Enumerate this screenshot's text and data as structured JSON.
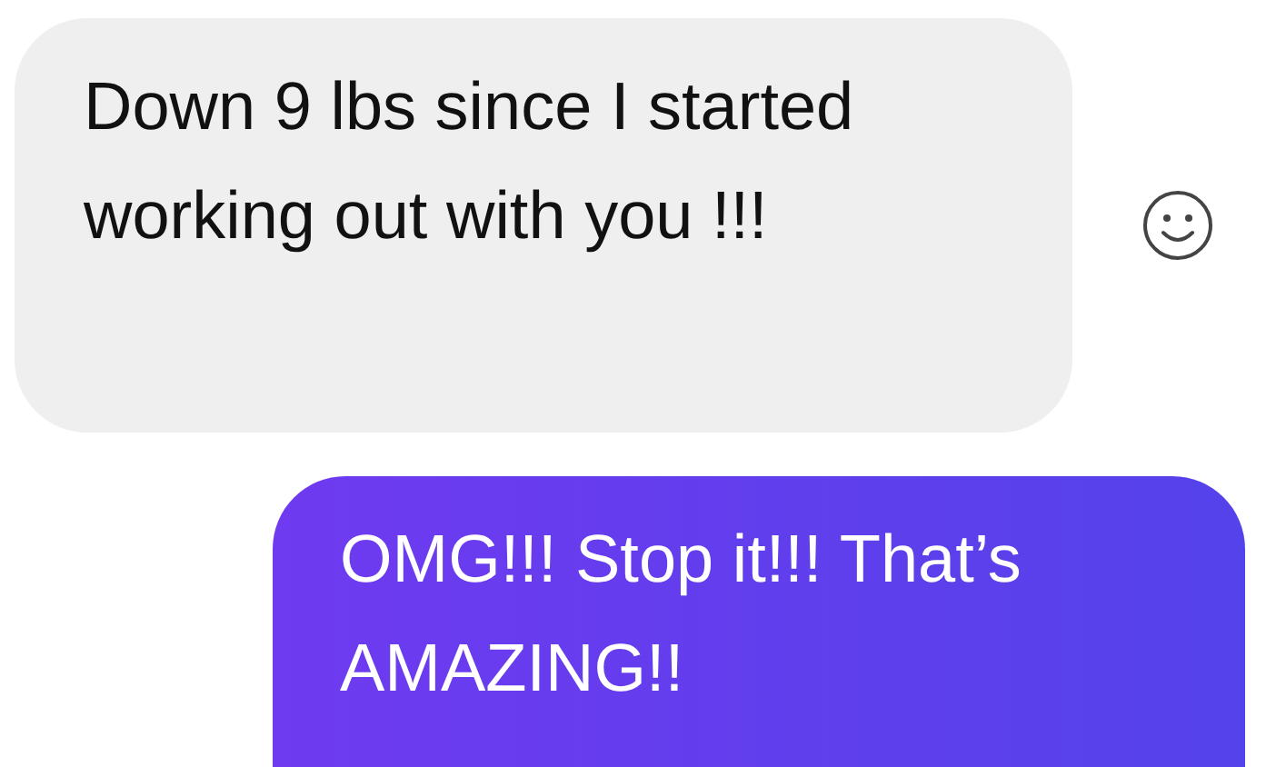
{
  "messages": [
    {
      "kind": "received",
      "text": "Down 9 lbs since I started working out with you !!!"
    },
    {
      "kind": "sent",
      "text": "OMG!!! Stop it!!! That’s AMAZING!!"
    }
  ]
}
